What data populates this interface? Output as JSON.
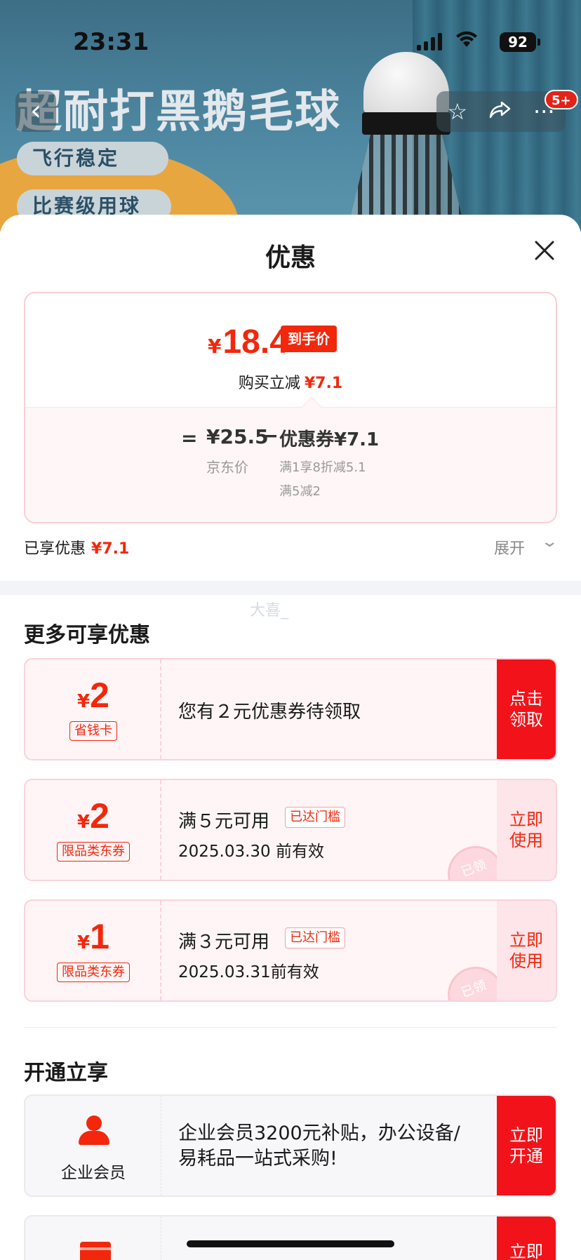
{
  "status_bar": {
    "time": "23:31",
    "battery": "92"
  },
  "banner": {
    "title": "超耐打黑鹅毛球",
    "pill1": "飞行稳定",
    "pill2": "比赛级用球"
  },
  "nav": {
    "badge": "5+",
    "icons": [
      "back-icon",
      "star-icon",
      "share-icon",
      "more-icon"
    ]
  },
  "sheet": {
    "title": "优惠",
    "close": "×"
  },
  "price": {
    "yen": "¥",
    "final_price": "18.4",
    "final_tag": "到手价",
    "direct_label": "购买立减",
    "direct_amount": "¥7.1",
    "equals": "=",
    "jd_price": "¥25.5",
    "jd_label": "京东价",
    "minus": "−",
    "coupon_sum": "优惠券¥7.1",
    "rule1": "满1享8折减5.1",
    "rule2": "满5减2"
  },
  "enjoyed": {
    "label": "已享优惠",
    "amount": "¥7.1",
    "expand": "展开"
  },
  "watermark": "大喜_",
  "more_offers": {
    "title": "更多可享优惠",
    "coupons": [
      {
        "yen": "¥",
        "amount": "2",
        "tag": "省钱卡",
        "text": "您有２元优惠券待领取",
        "action": "点击领取"
      },
      {
        "yen": "¥",
        "amount": "2",
        "tag": "限品类东券",
        "condition": "满５元可用",
        "reach": "已达门槛",
        "valid": "2025.03.30 前有效",
        "action": "立即使用",
        "stamp": "已领"
      },
      {
        "yen": "¥",
        "amount": "1",
        "tag": "限品类东券",
        "condition": "满３元可用",
        "reach": "已达门槛",
        "valid": "2025.03.31前有效",
        "action": "立即使用",
        "stamp": "已领"
      }
    ]
  },
  "open_enjoy": {
    "title": "开通立享",
    "vip": {
      "label": "企业会员",
      "text": "企业会员3200元补贴，办公设备/易耗品一站式采购!",
      "action": "立即开通"
    },
    "vip2": {
      "text": "…",
      "action": "立即"
    }
  },
  "colors": {
    "accent": "#f2270c",
    "coupon_bg": "#fff5f6",
    "action_red": "#f2131a"
  }
}
